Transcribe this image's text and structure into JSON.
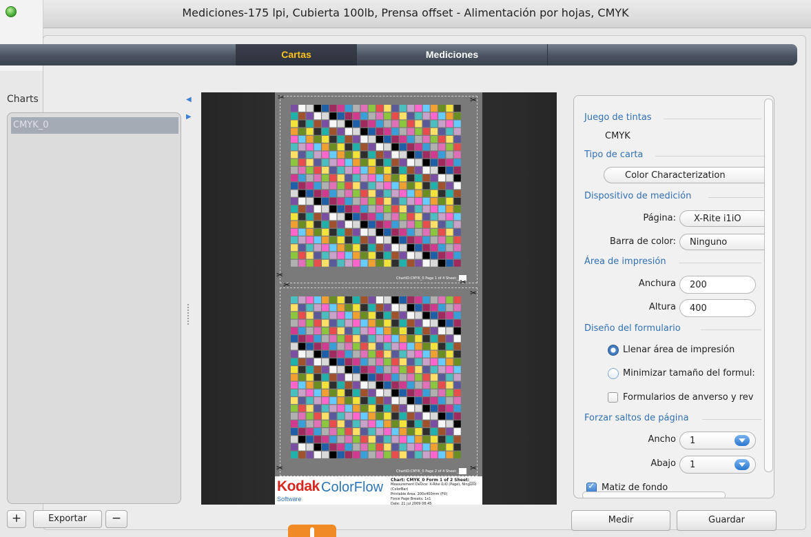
{
  "window": {
    "title": "Mediciones-175 lpi, Cubierta 100lb, Prensa offset - Alimentación por hojas, CMYK"
  },
  "tabs": [
    {
      "label": "Cartas",
      "selected": true
    },
    {
      "label": "Mediciones",
      "selected": false
    }
  ],
  "charts": {
    "label": "Charts",
    "items": [
      "CMYK_0"
    ],
    "selected": "CMYK_0"
  },
  "list_buttons": {
    "add": "+",
    "export": "Exportar",
    "remove": "−"
  },
  "preview": {
    "page1_caption": "ChartID:CMYK_0 Page 1 of 4  Sheet:__",
    "page2_caption": "ChartID:CMYK_0 Page 2 of 4  Sheet:__",
    "logo_brand": "Kodak",
    "logo_product": "ColorFlow",
    "logo_sub": "Software",
    "info_line1": "Chart: CMYK_0   Form 1 of 2  Sheet:___",
    "info_line2": "Measurement Device: X-Rite i1iO (Page), Ninguno (ColorBar)",
    "info_line3": "Printable Area: 200x400mm (Fill)",
    "info_line4": "Force Page Breaks: 1x1",
    "info_line5": "Date: 21 jul 2009 08:45"
  },
  "settings": {
    "ink_set": {
      "heading": "Juego de tintas",
      "value": "CMYK"
    },
    "chart_type": {
      "heading": "Tipo de carta",
      "value": "Color Characterization"
    },
    "device": {
      "heading": "Dispositivo de medición",
      "page_label": "Página:",
      "page_value": "X-Rite i1iO",
      "bar_label": "Barra de color:",
      "bar_value": "Ninguno"
    },
    "print_area": {
      "heading": "Área de impresión",
      "width_label": "Anchura",
      "width_value": "200",
      "height_label": "Altura",
      "height_value": "400"
    },
    "form_design": {
      "heading": "Diseño del formulario",
      "fill_label": "Llenar área de impresión",
      "minimize_label": "Minimizar tamaño del formul:",
      "duplex_label": "Formularios de anverso y rev",
      "selected": "fill"
    },
    "page_breaks": {
      "heading": "Forzar saltos de página",
      "across_label": "Ancho",
      "across_value": "1",
      "down_label": "Abajo",
      "down_value": "1"
    },
    "bg_tint": {
      "label": "Matiz de fondo",
      "checked": true
    }
  },
  "actions": {
    "measure": "Medir",
    "save": "Guardar"
  },
  "colors": {
    "tab_active": "#ffc21a",
    "section_heading": "#3270b4",
    "kodak_red": "#d7261e",
    "colorflow_blue": "#2d74b7"
  }
}
